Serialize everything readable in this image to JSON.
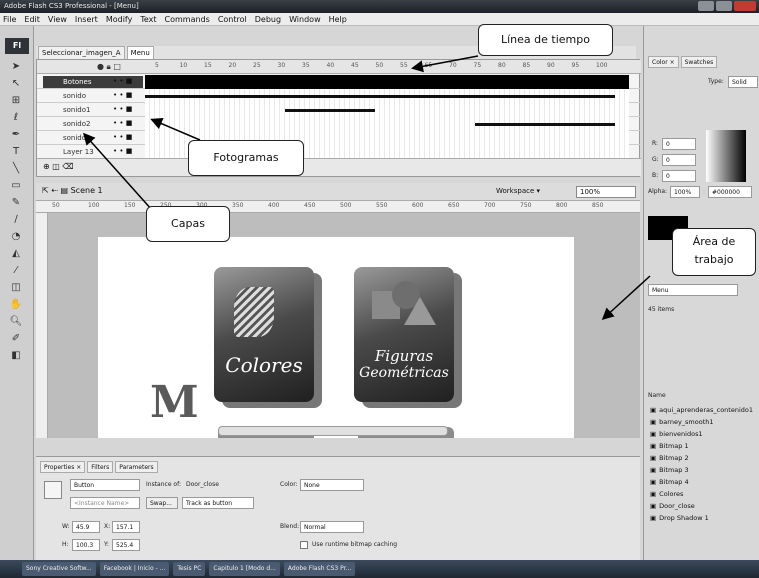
{
  "window": {
    "title": "Adobe Flash CS3 Professional - [Menu]"
  },
  "menu": [
    "File",
    "Edit",
    "View",
    "Insert",
    "Modify",
    "Text",
    "Commands",
    "Control",
    "Debug",
    "Window",
    "Help"
  ],
  "doc_tabs": [
    "Seleccionar_imagen_A",
    "Menu"
  ],
  "timeline": {
    "frame_numbers": [
      "5",
      "10",
      "15",
      "20",
      "25",
      "30",
      "35",
      "40",
      "45",
      "50",
      "55",
      "65",
      "70",
      "75",
      "80",
      "85",
      "90",
      "95",
      "100"
    ],
    "layers": [
      {
        "name": "Botones",
        "selected": true
      },
      {
        "name": "sonido",
        "selected": false
      },
      {
        "name": "sonido1",
        "selected": false
      },
      {
        "name": "sonido2",
        "selected": false
      },
      {
        "name": "sonido3",
        "selected": false
      },
      {
        "name": "Layer 13",
        "selected": false
      }
    ]
  },
  "stage": {
    "scene": "Scene 1",
    "workspace": "Workspace ▾",
    "zoom": "100%",
    "ruler_numbers": [
      "50",
      "100",
      "150",
      "250",
      "300",
      "350",
      "400",
      "450",
      "500",
      "550",
      "600",
      "650",
      "700",
      "750",
      "800",
      "850"
    ],
    "letter": "M",
    "card1_text": "Colores",
    "card2_text_1": "Figuras",
    "card2_text_2": "Geométricas"
  },
  "properties": {
    "tabs": [
      "Properties ×",
      "Filters",
      "Parameters"
    ],
    "type": "Button",
    "instance_name_placeholder": "<Instance Name>",
    "instance_of_label": "Instance of:",
    "instance_of": "Door_close",
    "swap": "Swap...",
    "track": "Track as button",
    "color_label": "Color:",
    "color": "None",
    "blend_label": "Blend:",
    "blend": "Normal",
    "cache": "Use runtime bitmap caching",
    "w_label": "W:",
    "w": "45.9",
    "x_label": "X:",
    "x": "157.1",
    "h_label": "H:",
    "h": "100.3",
    "y_label": "Y:",
    "y": "525.4"
  },
  "right_panel": {
    "tabs": [
      "Color ×",
      "Swatches"
    ],
    "type_label": "Type:",
    "type": "Solid",
    "r_label": "R:",
    "r": "0",
    "g_label": "G:",
    "g": "0",
    "b_label": "B:",
    "b": "0",
    "alpha_label": "Alpha:",
    "alpha": "100%",
    "hex": "#000000",
    "library_select": "Menu",
    "items_count": "45 items",
    "name_header": "Name",
    "items": [
      "aqui_aprenderas_contenido1",
      "barney_smooth1",
      "bienvenidos1",
      "Bitmap 1",
      "Bitmap 2",
      "Bitmap 3",
      "Bitmap 4",
      "Colores",
      "Door_close",
      "Drop Shadow 1"
    ]
  },
  "taskbar": [
    "Sony Creative Softw...",
    "Facebook | Inicio - ...",
    "Tesis PC",
    "Capitulo 1 [Modo d...",
    "Adobe Flash CS3 Pr..."
  ],
  "annotations": {
    "timeline": "Línea de tiempo",
    "frames": "Fotogramas",
    "layers": "Capas",
    "work_area_1": "Área de",
    "work_area_2": "trabajo"
  },
  "colors": {
    "accent": "#2f3337",
    "stage_bg": "#bdbdbd",
    "canvas": "#ffffff"
  }
}
